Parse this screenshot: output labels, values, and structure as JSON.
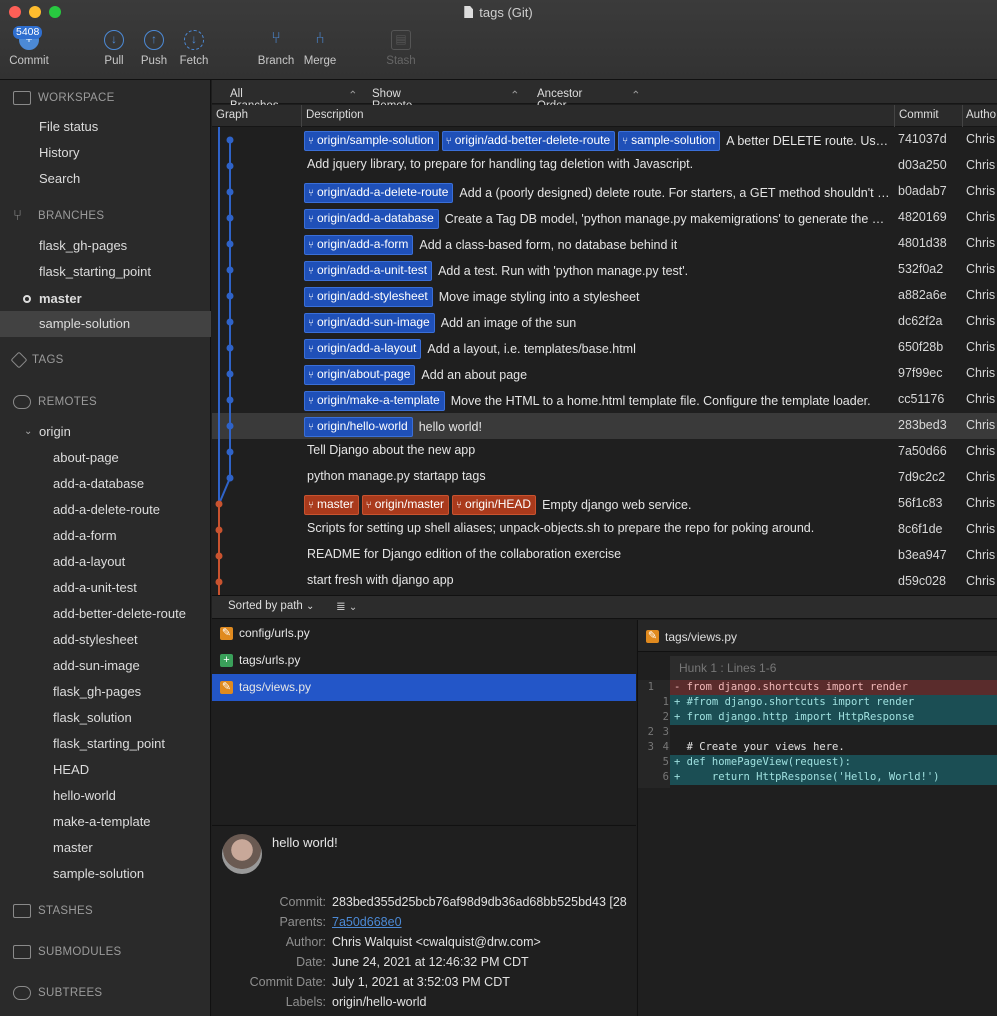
{
  "window": {
    "title": "tags (Git)"
  },
  "toolbar": {
    "commit": {
      "label": "Commit",
      "badge": "5408"
    },
    "pull": "Pull",
    "push": "Push",
    "fetch": "Fetch",
    "branch": "Branch",
    "merge": "Merge",
    "stash": "Stash"
  },
  "sidebar": {
    "workspace": {
      "title": "WORKSPACE",
      "items": [
        "File status",
        "History",
        "Search"
      ]
    },
    "branches": {
      "title": "BRANCHES",
      "items": [
        "flask_gh-pages",
        "flask_starting_point",
        "master",
        "sample-solution"
      ],
      "current": "master",
      "selected": "sample-solution"
    },
    "tags": {
      "title": "TAGS"
    },
    "remotes": {
      "title": "REMOTES",
      "origin": "origin",
      "items": [
        "about-page",
        "add-a-database",
        "add-a-delete-route",
        "add-a-form",
        "add-a-layout",
        "add-a-unit-test",
        "add-better-delete-route",
        "add-stylesheet",
        "add-sun-image",
        "flask_gh-pages",
        "flask_solution",
        "flask_starting_point",
        "HEAD",
        "hello-world",
        "make-a-template",
        "master",
        "sample-solution"
      ]
    },
    "stashes": {
      "title": "STASHES"
    },
    "submodules": {
      "title": "SUBMODULES"
    },
    "subtrees": {
      "title": "SUBTREES"
    }
  },
  "filters": {
    "branches": "All Branches",
    "remote": "Show Remote Branches",
    "order": "Ancestor Order"
  },
  "columns": {
    "graph": "Graph",
    "description": "Description",
    "commit": "Commit",
    "author": "Autho"
  },
  "commits": [
    {
      "tags": [
        "origin/sample-solution",
        "origin/add-better-delete-route",
        "sample-solution"
      ],
      "tag_color": "blue",
      "desc": "A better DELETE route. Use a form to do the deletion, rather than anchor tag.",
      "hash": "741037d",
      "author": "Chris"
    },
    {
      "tags": [],
      "desc": "Add jquery library, to prepare for handling tag deletion with Javascript.",
      "hash": "d03a250",
      "author": "Chris"
    },
    {
      "tags": [
        "origin/add-a-delete-route"
      ],
      "tag_color": "blue",
      "desc": "Add a (poorly designed) delete route.  For starters, a GET method shouldn't change state.",
      "hash": "b0adab7",
      "author": "Chris"
    },
    {
      "tags": [
        "origin/add-a-database"
      ],
      "tag_color": "blue",
      "desc": "Create a Tag DB model, 'python manage.py makemigrations' to generate the migration.",
      "hash": "4820169",
      "author": "Chris"
    },
    {
      "tags": [
        "origin/add-a-form"
      ],
      "tag_color": "blue",
      "desc": "Add a class-based form, no database behind it",
      "hash": "4801d38",
      "author": "Chris"
    },
    {
      "tags": [
        "origin/add-a-unit-test"
      ],
      "tag_color": "blue",
      "desc": "Add a test.  Run with 'python manage.py test'.",
      "hash": "532f0a2",
      "author": "Chris"
    },
    {
      "tags": [
        "origin/add-stylesheet"
      ],
      "tag_color": "blue",
      "desc": "Move image styling into a stylesheet",
      "hash": "a882a6e",
      "author": "Chris"
    },
    {
      "tags": [
        "origin/add-sun-image"
      ],
      "tag_color": "blue",
      "desc": "Add an image of the sun",
      "hash": "dc62f2a",
      "author": "Chris"
    },
    {
      "tags": [
        "origin/add-a-layout"
      ],
      "tag_color": "blue",
      "desc": "Add a layout, i.e. templates/base.html",
      "hash": "650f28b",
      "author": "Chris"
    },
    {
      "tags": [
        "origin/about-page"
      ],
      "tag_color": "blue",
      "desc": "Add an about page",
      "hash": "97f99ec",
      "author": "Chris"
    },
    {
      "tags": [
        "origin/make-a-template"
      ],
      "tag_color": "blue",
      "desc": "Move the HTML to a home.html template file.  Configure the template loader.",
      "hash": "cc51176",
      "author": "Chris"
    },
    {
      "tags": [
        "origin/hello-world"
      ],
      "tag_color": "blue",
      "desc": "hello world!",
      "hash": "283bed3",
      "author": "Chris",
      "selected": true
    },
    {
      "tags": [],
      "desc": "Tell Django about the new app",
      "hash": "7a50d66",
      "author": "Chris"
    },
    {
      "tags": [],
      "desc": "python manage.py startapp tags",
      "hash": "7d9c2c2",
      "author": "Chris"
    },
    {
      "tags": [
        "master",
        "origin/master",
        "origin/HEAD"
      ],
      "tag_color": "red",
      "desc": "Empty django web service.",
      "hash": "56f1c83",
      "author": "Chris"
    },
    {
      "tags": [],
      "desc": "Scripts for setting up shell aliases; unpack-objects.sh to prepare the repo for poking around.",
      "hash": "8c6f1de",
      "author": "Chris"
    },
    {
      "tags": [],
      "desc": "README for Django edition of the collaboration exercise",
      "hash": "b3ea947",
      "author": "Chris"
    },
    {
      "tags": [],
      "desc": "start fresh with django app",
      "hash": "d59c028",
      "author": "Chris"
    }
  ],
  "files_bar": {
    "sort": "Sorted by path"
  },
  "files": [
    {
      "name": "config/urls.py",
      "status": "modified"
    },
    {
      "name": "tags/urls.py",
      "status": "added"
    },
    {
      "name": "tags/views.py",
      "status": "modified",
      "selected": true
    }
  ],
  "commit_info": {
    "subject": "hello world!",
    "labels": {
      "commit": "Commit:",
      "parents": "Parents:",
      "author": "Author:",
      "date": "Date:",
      "commit_date": "Commit Date:",
      "labels": "Labels:"
    },
    "commit": "283bed355d25bcb76af98d9db36ad68bb525bd43 [28",
    "parents": "7a50d668e0",
    "author": "Chris Walquist <cwalquist@drw.com>",
    "date": "June 24, 2021 at 12:46:32 PM CDT",
    "commit_date": "July 1, 2021 at 3:52:03 PM CDT",
    "label_value": "origin/hello-world"
  },
  "diff": {
    "file": "tags/views.py",
    "hunk": "Hunk 1 : Lines 1-6",
    "lines": [
      {
        "type": "del",
        "old": "1",
        "new": "",
        "text": "- from django.shortcuts import render"
      },
      {
        "type": "ins",
        "old": "",
        "new": "1",
        "text": "+ #from django.shortcuts import render"
      },
      {
        "type": "ins",
        "old": "",
        "new": "2",
        "text": "+ from django.http import HttpResponse"
      },
      {
        "type": "ctx",
        "old": "2",
        "new": "3",
        "text": ""
      },
      {
        "type": "ctx",
        "old": "3",
        "new": "4",
        "text": "  # Create your views here."
      },
      {
        "type": "ins",
        "old": "",
        "new": "5",
        "text": "+ def homePageView(request):"
      },
      {
        "type": "ins",
        "old": "",
        "new": "6",
        "text": "+     return HttpResponse('Hello, World!')"
      }
    ]
  },
  "colors": {
    "branch_blue": "#2f63c8",
    "branch_red": "#c9532f",
    "selection": "#2356c8"
  }
}
